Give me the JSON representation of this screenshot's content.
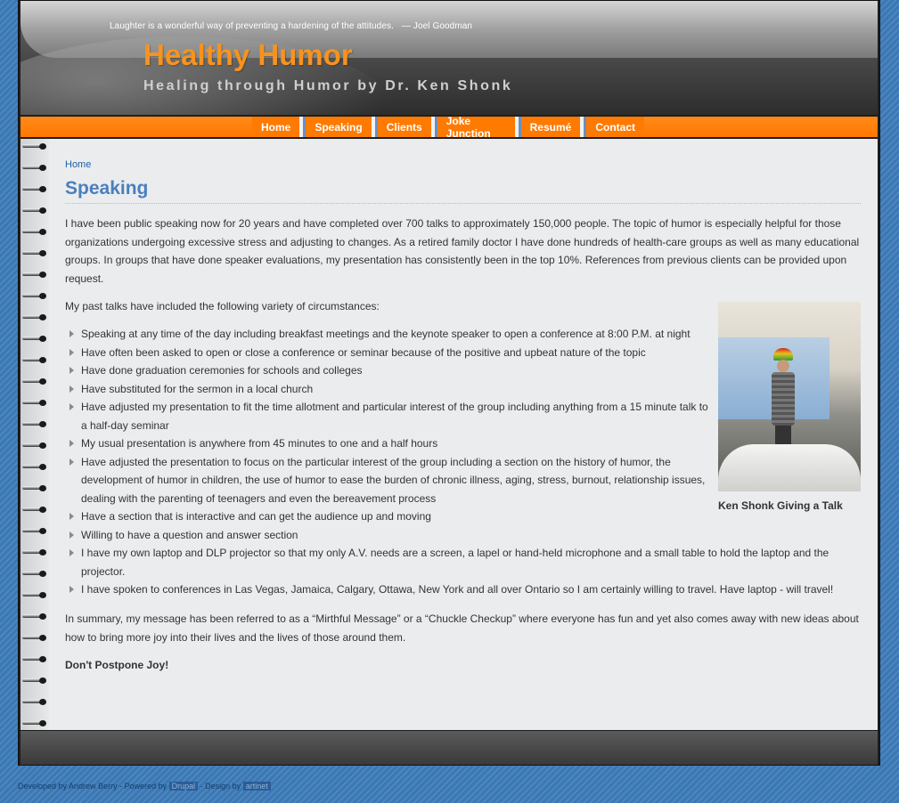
{
  "header": {
    "quote": "Laughter is a wonderful way of preventing a hardening of the attitudes.",
    "quote_author": "— Joel Goodman",
    "site_name": "Healthy Humor",
    "slogan": "Healing through Humor by Dr. Ken Shonk"
  },
  "nav": {
    "items": [
      {
        "label": "Home"
      },
      {
        "label": "Speaking"
      },
      {
        "label": "Clients"
      },
      {
        "label": "Joke Junction"
      },
      {
        "label": "Resumé"
      },
      {
        "label": "Contact"
      }
    ]
  },
  "breadcrumb": "Home",
  "page_title": "Speaking",
  "intro": "I have been public speaking now for 20 years and have completed over 700 talks to approximately 150,000 people. The topic of humor is especially helpful for those organizations undergoing excessive stress and adjusting to changes. As a retired family doctor I have done hundreds of health-care groups as well as many educational groups. In groups that have done speaker evaluations, my presentation has consistently been in the top 10%. References from previous clients can be provided upon request.",
  "past_talks_intro": "My past talks have included the following variety of circumstances:",
  "bullets": [
    "Speaking at any time of the day including breakfast meetings and the keynote speaker to open a conference at 8:00 P.M. at night",
    "Have often been asked to open or close a conference or seminar because of the positive and upbeat nature of the topic",
    "Have done graduation ceremonies for schools and colleges",
    "Have substituted for the sermon in a local church",
    "Have adjusted my presentation to fit the time allotment and particular interest of the group including anything from a 15 minute talk to a half-day seminar",
    "My usual presentation is anywhere from 45 minutes to one and a half hours",
    "Have adjusted the presentation to focus on the particular interest of the group including a section on the history of humor, the development of humor in children, the use of humor to ease the burden of chronic illness, aging, stress, burnout, relationship issues, dealing with the parenting of teenagers and even the bereavement process",
    "Have a section that is interactive and can get the audience up and moving",
    "Willing to have a question and answer section",
    "I have my own laptop and DLP projector so that my only A.V. needs are a screen, a lapel or hand-held microphone and a small table to hold the laptop and the projector.",
    "I have spoken to conferences in Las Vegas, Jamaica, Calgary, Ottawa, New York and all over Ontario so I am certainly willing to travel. Have laptop - will travel!"
  ],
  "figure_caption": "Ken Shonk Giving a Talk",
  "summary": "In summary, my message has been referred to as a “Mirthful Message” or a “Chuckle Checkup” where everyone has fun and yet also comes away with new ideas about how to bring more joy into their lives and the lives of those around them.",
  "closing": "Don't Postpone Joy!",
  "footer": {
    "developed_by": "Developed by Andrew Berry - Powered by",
    "powered_by_link": "Drupal",
    "design_by_text": "- Design by",
    "design_by_link": "artinet"
  },
  "colors": {
    "accent_orange": "#f7931e",
    "nav_orange": "#ff7a00",
    "link_blue": "#1f5fa8",
    "title_blue": "#4a7fbf",
    "page_bg_blue": "#3a78b5"
  }
}
